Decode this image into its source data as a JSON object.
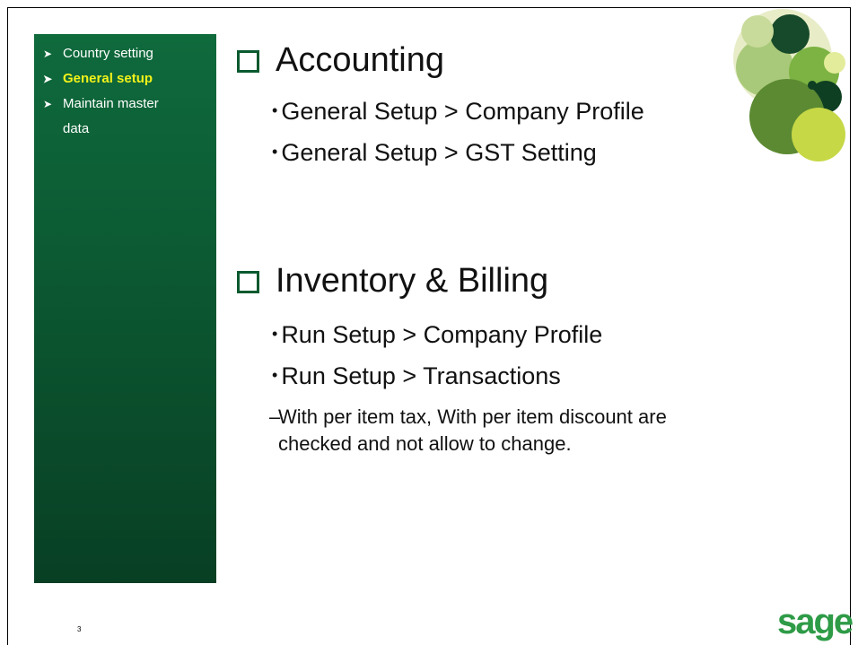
{
  "sidebar": {
    "items": [
      {
        "label": "Country setting"
      },
      {
        "label": "General setup"
      },
      {
        "label": "Maintain master"
      },
      {
        "label": "data"
      }
    ]
  },
  "sections": [
    {
      "title": "Accounting",
      "bullets": [
        "General Setup > Company Profile",
        "General Setup > GST Setting"
      ]
    },
    {
      "title": "Inventory & Billing",
      "bullets": [
        "Run Setup > Company Profile",
        "Run Setup > Transactions"
      ],
      "subnote": "With per item tax, With per item discount are checked and not allow to change."
    }
  ],
  "footer": {
    "slide_number": "3",
    "logo_text": "sage"
  },
  "colors": {
    "sidebar_green": "#0c5a33",
    "active_nav": "#f2f21a",
    "logo_green": "#2e9b47"
  }
}
